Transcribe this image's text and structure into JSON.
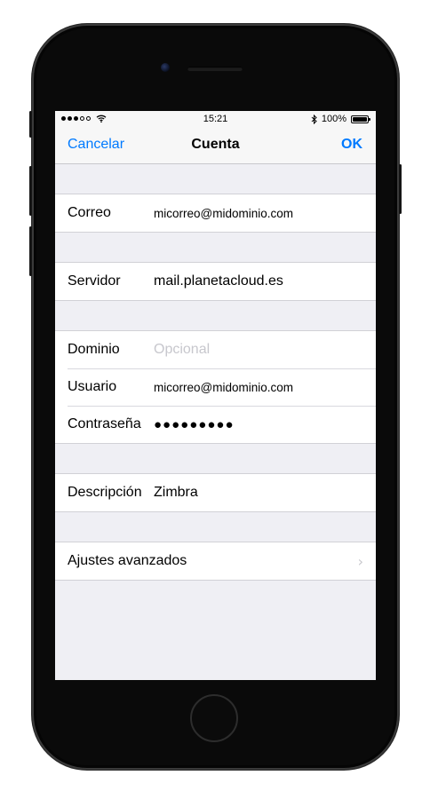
{
  "status": {
    "signal_filled": 3,
    "signal_total": 5,
    "time": "15:21",
    "battery": "100%",
    "wifi_icon": "wifi-icon",
    "bluetooth_icon": "bluetooth-icon"
  },
  "nav": {
    "cancel": "Cancelar",
    "title": "Cuenta",
    "ok": "OK",
    "accent_color": "#007aff"
  },
  "fields": {
    "correo_label": "Correo",
    "correo_value": "micorreo@midominio.com",
    "servidor_label": "Servidor",
    "servidor_value": "mail.planetacloud.es",
    "dominio_label": "Dominio",
    "dominio_placeholder": "Opcional",
    "usuario_label": "Usuario",
    "usuario_value": "micorreo@midominio.com",
    "contrasena_label": "Contraseña",
    "contrasena_value": "●●●●●●●●●",
    "descripcion_label": "Descripción",
    "descripcion_value": "Zimbra",
    "ajustes_label": "Ajustes avanzados"
  }
}
